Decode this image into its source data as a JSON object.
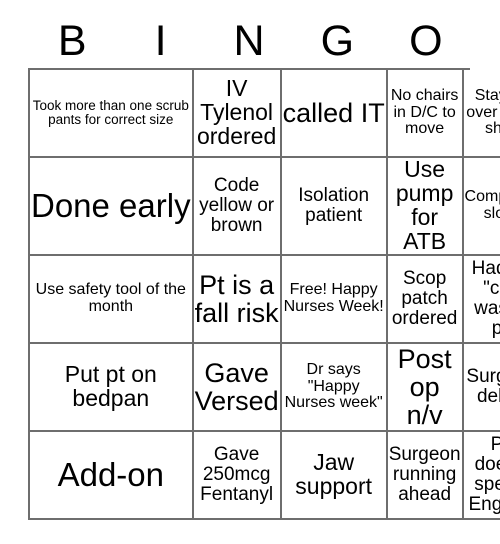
{
  "card": {
    "title_letters": [
      "B",
      "I",
      "N",
      "G",
      "O"
    ],
    "columns": 5,
    "rows": 5,
    "colors": {
      "background": "#ffffff",
      "text": "#000000",
      "grid_line": "#6e6e6e"
    },
    "cells": [
      {
        "id": "b1",
        "text": "Took more than one scrub pants for correct size",
        "size": "xs"
      },
      {
        "id": "i1",
        "text": "IV Tylenol ordered",
        "size": "lg"
      },
      {
        "id": "n1",
        "text": "called IT",
        "size": "xl",
        "overflow": true
      },
      {
        "id": "g1",
        "text": "No chairs in D/C to move",
        "size": "sm"
      },
      {
        "id": "o1",
        "text": "Stayed over your shift",
        "size": "sm"
      },
      {
        "id": "b2",
        "text": "Done early",
        "size": "xxl",
        "overflow": true
      },
      {
        "id": "i2",
        "text": "Code yellow or brown",
        "size": "md"
      },
      {
        "id": "n2",
        "text": "Isolation patient",
        "size": "md"
      },
      {
        "id": "g2",
        "text": "Use pump for ATB",
        "size": "lg"
      },
      {
        "id": "o2",
        "text": "Computer slow",
        "size": "sm"
      },
      {
        "id": "b3",
        "text": "Use safety tool of the month",
        "size": "sm"
      },
      {
        "id": "i3",
        "text": "Pt is a fall risk",
        "size": "xl"
      },
      {
        "id": "n3",
        "text": "Free! Happy Nurses Week!",
        "size": "sm"
      },
      {
        "id": "g3",
        "text": "Scop patch ordered",
        "size": "md"
      },
      {
        "id": "o3",
        "text": "Had to \"car wash\" pt",
        "size": "md"
      },
      {
        "id": "b4",
        "text": "Put pt on bedpan",
        "size": "lg"
      },
      {
        "id": "i4",
        "text": "Gave Versed",
        "size": "xl"
      },
      {
        "id": "n4",
        "text": "Dr says \"Happy Nurses week\"",
        "size": "sm"
      },
      {
        "id": "g4",
        "text": "Post op n/v",
        "size": "xl"
      },
      {
        "id": "o4",
        "text": "Surgery delay",
        "size": "md"
      },
      {
        "id": "b5",
        "text": "Add-on",
        "size": "xxl"
      },
      {
        "id": "i5",
        "text": "Gave 250mcg Fentanyl",
        "size": "md"
      },
      {
        "id": "n5",
        "text": "Jaw support",
        "size": "lg"
      },
      {
        "id": "g5",
        "text": "Surgeon running ahead",
        "size": "md"
      },
      {
        "id": "o5",
        "text": "Pt does't speak Engilsh",
        "size": "md"
      }
    ]
  }
}
